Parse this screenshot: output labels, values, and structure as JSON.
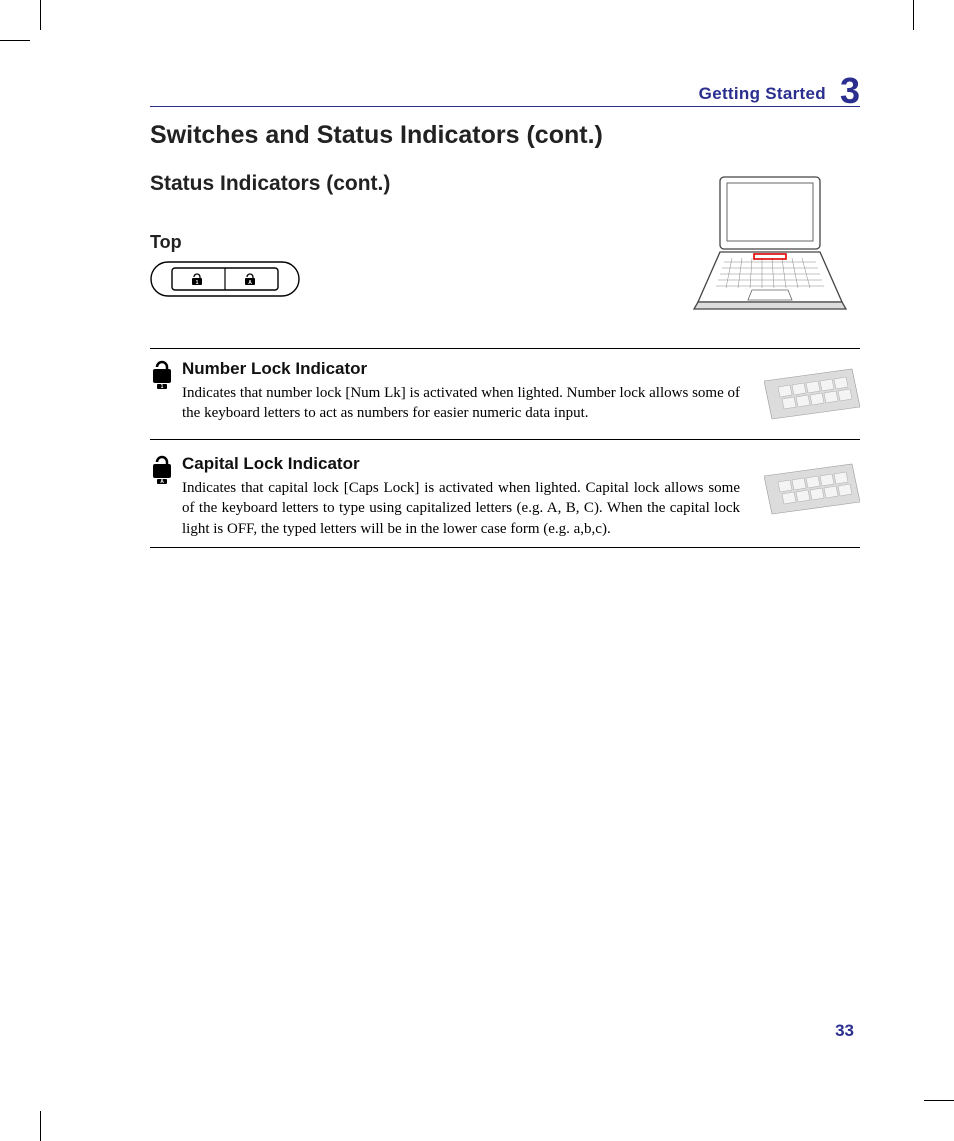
{
  "header": {
    "label": "Getting Started",
    "chapter": "3"
  },
  "section_title": "Switches and Status Indicators (cont.)",
  "sub_title": "Status Indicators (cont.)",
  "tiny_title": "Top",
  "items": [
    {
      "icon_badge": "1",
      "title": "Number Lock Indicator",
      "body": "Indicates that number lock [Num Lk] is activated when lighted. Number lock allows some of the  keyboard letters to act as numbers for easier numeric data input."
    },
    {
      "icon_badge": "A",
      "title": "Capital Lock Indicator",
      "body": "Indicates that capital lock [Caps Lock] is activated when lighted. Capital lock allows some of the keyboard letters to type using capitalized letters (e.g. A, B, C). When the capital lock light is OFF, the typed letters will be in the lower case form (e.g. a,b,c)."
    }
  ],
  "page_number": "33"
}
